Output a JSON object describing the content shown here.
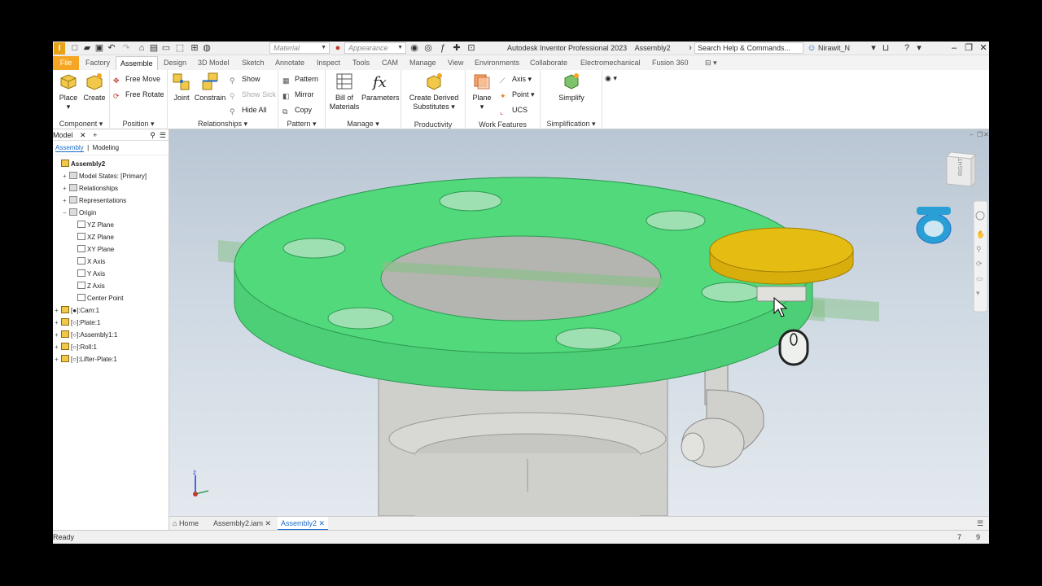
{
  "titlebar": {
    "logo": "I",
    "material": "Material",
    "appearance": "Appearance",
    "title": "Autodesk Inventor Professional 2023",
    "document": "Assembly2",
    "search_placeholder": "Search Help & Commands...",
    "user": "Nirawit_N"
  },
  "tabs": [
    "File",
    "Factory",
    "Assemble",
    "Design",
    "3D Model",
    "Sketch",
    "Annotate",
    "Inspect",
    "Tools",
    "CAM",
    "Manage",
    "View",
    "Environments",
    "Collaborate",
    "Electromechanical",
    "Fusion 360"
  ],
  "active_tab": "Assemble",
  "ribbon": {
    "component": {
      "label": "Component",
      "place": "Place",
      "create": "Create"
    },
    "position": {
      "label": "Position",
      "free_move": "Free Move",
      "free_rotate": "Free Rotate"
    },
    "relationships": {
      "label": "Relationships",
      "joint": "Joint",
      "constrain": "Constrain",
      "show": "Show",
      "show_sick": "Show Sick",
      "hide_all": "Hide All"
    },
    "pattern": {
      "label": "Pattern",
      "pattern": "Pattern",
      "mirror": "Mirror",
      "copy": "Copy"
    },
    "manage": {
      "label": "Manage",
      "bom_line1": "Bill of",
      "bom_line2": "Materials",
      "parameters": "Parameters"
    },
    "productivity": {
      "label": "Productivity",
      "cds_line1": "Create Derived",
      "cds_line2": "Substitutes"
    },
    "work_features": {
      "label": "Work Features",
      "plane": "Plane",
      "axis": "Axis",
      "point": "Point",
      "ucs": "UCS"
    },
    "simplification": {
      "label": "Simplification",
      "simplify": "Simplify"
    }
  },
  "browser": {
    "title": "Model",
    "sub_tabs": [
      "Assembly",
      "Modeling"
    ],
    "tree": [
      {
        "label": "Assembly2",
        "level": 0,
        "toggle": "",
        "icon": "assembly"
      },
      {
        "label": "Model States: [Primary]",
        "level": 1,
        "toggle": "+",
        "icon": "folder"
      },
      {
        "label": "Relationships",
        "level": 1,
        "toggle": "+",
        "icon": "folder"
      },
      {
        "label": "Representations",
        "level": 1,
        "toggle": "+",
        "icon": "representations"
      },
      {
        "label": "Origin",
        "level": 1,
        "toggle": "−",
        "icon": "folder"
      },
      {
        "label": "YZ Plane",
        "level": 2,
        "toggle": "",
        "icon": "plane"
      },
      {
        "label": "XZ Plane",
        "level": 2,
        "toggle": "",
        "icon": "plane"
      },
      {
        "label": "XY Plane",
        "level": 2,
        "toggle": "",
        "icon": "plane"
      },
      {
        "label": "X Axis",
        "level": 2,
        "toggle": "",
        "icon": "plane"
      },
      {
        "label": "Y Axis",
        "level": 2,
        "toggle": "",
        "icon": "plane"
      },
      {
        "label": "Z Axis",
        "level": 2,
        "toggle": "",
        "icon": "plane"
      },
      {
        "label": "Center Point",
        "level": 2,
        "toggle": "",
        "icon": "point"
      },
      {
        "label": "[●]:Cam:1",
        "level": 0,
        "toggle": "+",
        "icon": "grounded-part"
      },
      {
        "label": "[○]:Plate:1",
        "level": 0,
        "toggle": "+",
        "icon": "part"
      },
      {
        "label": "[○]:Assembly1:1",
        "level": 0,
        "toggle": "+",
        "icon": "subassembly"
      },
      {
        "label": "[○]:Roll:1",
        "level": 0,
        "toggle": "+",
        "icon": "part"
      },
      {
        "label": "[○]:Lifter-Plate:1",
        "level": 0,
        "toggle": "+",
        "icon": "part"
      }
    ]
  },
  "viewcube": {
    "face_label": "RIGHT"
  },
  "doc_tabs": [
    {
      "label": "Home",
      "closable": false
    },
    {
      "label": "Assembly2.iam",
      "closable": true
    },
    {
      "label": "Assembly2",
      "closable": true,
      "active": true
    }
  ],
  "status": {
    "text": "Ready",
    "num1": "7",
    "num2": "9"
  },
  "colors": {
    "ribbon_file": "#f5a623",
    "plate_green": "#4ccf76",
    "lifter_yellow": "#e5bd12",
    "accent_blue": "#1b6ac9"
  }
}
